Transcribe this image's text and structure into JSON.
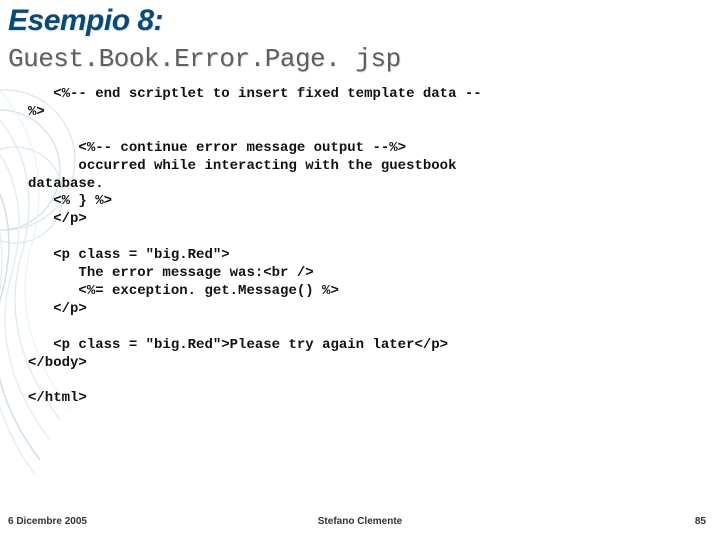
{
  "header": {
    "title": "Esempio 8:",
    "subtitle": "Guest.Book.Error.Page. jsp"
  },
  "code": "   <%-- end scriptlet to insert fixed template data --\n%>\n\n      <%-- continue error message output --%>\n      occurred while interacting with the guestbook\ndatabase.\n   <% } %>\n   </p>\n\n   <p class = \"big.Red\">\n      The error message was:<br />\n      <%= exception. get.Message() %>\n   </p>\n\n   <p class = \"big.Red\">Please try again later</p>\n</body>\n\n</html>",
  "footer": {
    "date": "6 Dicembre 2005",
    "author": "Stefano Clemente",
    "page": "85"
  }
}
